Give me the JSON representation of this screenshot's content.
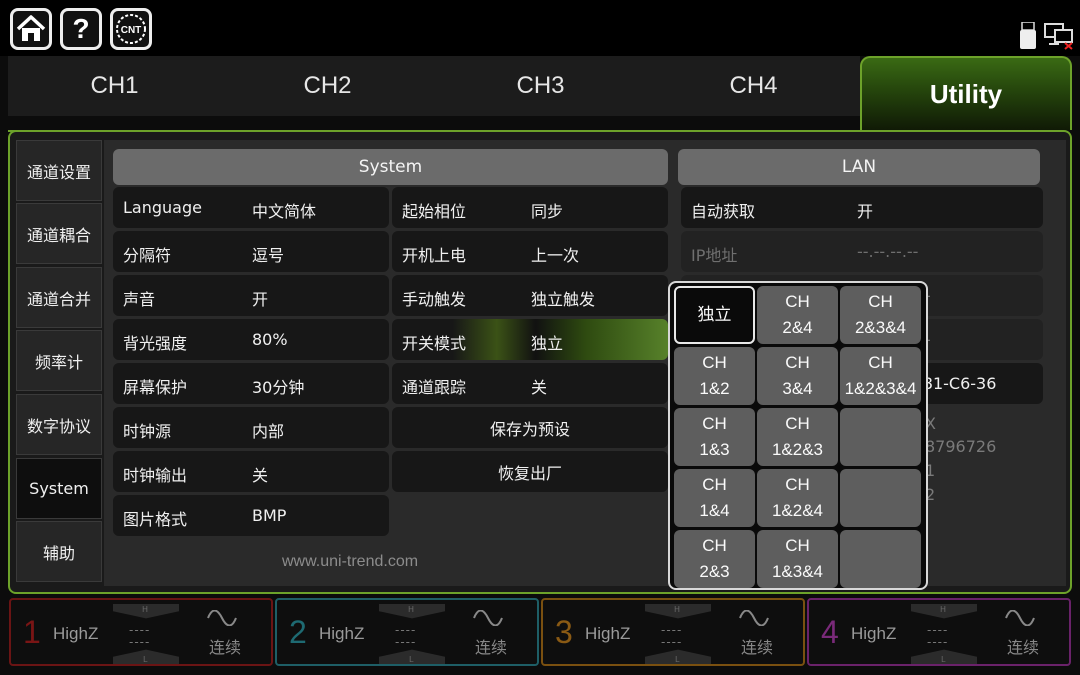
{
  "topbar": {
    "icons": [
      "home-icon",
      "help-icon",
      "cnt-icon",
      "usb-icon",
      "network-disconnected-icon"
    ],
    "help_label": "?",
    "cnt_label": "CNT"
  },
  "tabs": [
    "CH1",
    "CH2",
    "CH3",
    "CH4",
    "Utility"
  ],
  "sidebar": [
    "通道设置",
    "通道耦合",
    "通道合并",
    "频率计",
    "数字协议",
    "System",
    "辅助"
  ],
  "system": {
    "header": "System",
    "left": [
      {
        "label": "Language",
        "value": "中文简体"
      },
      {
        "label": "分隔符",
        "value": "逗号"
      },
      {
        "label": "声音",
        "value": "开"
      },
      {
        "label": "背光强度",
        "value": "80%"
      },
      {
        "label": "屏幕保护",
        "value": "30分钟"
      },
      {
        "label": "时钟源",
        "value": "内部"
      },
      {
        "label": "时钟输出",
        "value": "关"
      },
      {
        "label": "图片格式",
        "value": "BMP"
      }
    ],
    "right": [
      {
        "label": "起始相位",
        "value": "同步"
      },
      {
        "label": "开机上电",
        "value": "上一次"
      },
      {
        "label": "手动触发",
        "value": "独立触发"
      },
      {
        "label": "开关模式",
        "value": "独立"
      },
      {
        "label": "通道跟踪",
        "value": "关"
      }
    ],
    "save_preset": "保存为预设",
    "restore_factory": "恢复出厂",
    "website": "www.uni-trend.com"
  },
  "lan": {
    "header": "LAN",
    "auto_label": "自动获取",
    "auto_value": "开",
    "ip_label": "IP地址",
    "ip_value": "--.--.--.--",
    "partial_1": "-",
    "partial_2": "-",
    "mac_fragment": "-81-C6-36",
    "frag_a": "X",
    "frag_b": "8796726",
    "frag_c": "1",
    "frag_d": "2"
  },
  "popup": [
    [
      "独立"
    ],
    [
      "CH",
      "2&4"
    ],
    [
      "CH",
      "2&3&4"
    ],
    [
      "CH",
      "1&2"
    ],
    [
      "CH",
      "3&4"
    ],
    [
      "CH",
      "1&2&3&4"
    ],
    [
      "CH",
      "1&3"
    ],
    [
      "CH",
      "1&2&3"
    ],
    [],
    [
      "CH",
      "1&4"
    ],
    [
      "CH",
      "1&2&4"
    ],
    [],
    [
      "CH",
      "2&3"
    ],
    [
      "CH",
      "1&3&4"
    ],
    []
  ],
  "channels": [
    {
      "num": "1",
      "imp": "HighZ",
      "h": "H",
      "l": "L",
      "dash": "----",
      "mode": "连续",
      "color": "#7a1515"
    },
    {
      "num": "2",
      "imp": "HighZ",
      "h": "H",
      "l": "L",
      "dash": "----",
      "mode": "连续",
      "color": "#1e6a72"
    },
    {
      "num": "3",
      "imp": "HighZ",
      "h": "H",
      "l": "L",
      "dash": "----",
      "mode": "连续",
      "color": "#8a5a14"
    },
    {
      "num": "4",
      "imp": "HighZ",
      "h": "H",
      "l": "L",
      "dash": "----",
      "mode": "连续",
      "color": "#7a2a7a"
    }
  ]
}
